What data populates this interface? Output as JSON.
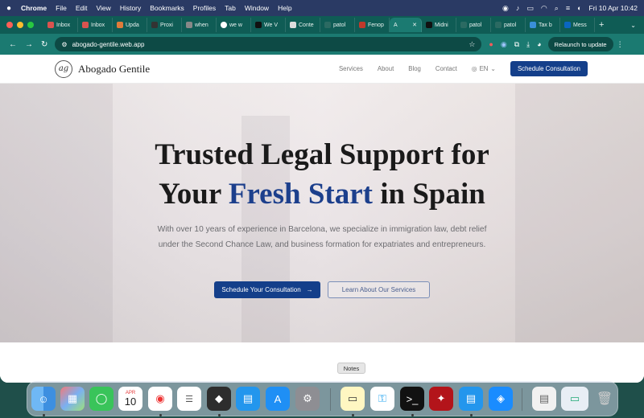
{
  "menubar": {
    "apple": "",
    "items": [
      "Chrome",
      "File",
      "Edit",
      "View",
      "History",
      "Bookmarks",
      "Profiles",
      "Tab",
      "Window",
      "Help"
    ],
    "datetime": "Fri 10 Apr  10:42"
  },
  "browser": {
    "tabs": [
      {
        "label": "Inbox"
      },
      {
        "label": "Inbox"
      },
      {
        "label": "Upda"
      },
      {
        "label": "Proxi"
      },
      {
        "label": "when"
      },
      {
        "label": "we w"
      },
      {
        "label": "We V"
      },
      {
        "label": "Conte"
      },
      {
        "label": "patol"
      },
      {
        "label": "Fenop"
      },
      {
        "label": "A",
        "active": true
      },
      {
        "label": "Midni"
      },
      {
        "label": "patol"
      },
      {
        "label": "patol"
      },
      {
        "label": "Tax b"
      },
      {
        "label": "Mess"
      }
    ],
    "new_tab": "+",
    "url": "abogado-gentile.web.app",
    "relaunch": "Relaunch to update"
  },
  "site": {
    "logo_mark": "ag",
    "logo_text": "Abogado Gentile",
    "nav": [
      "Services",
      "About",
      "Blog",
      "Contact"
    ],
    "lang": "EN",
    "cta": "Schedule Consultation",
    "hero": {
      "title_line1": "Trusted Legal Support for",
      "title_line2_pre": "Your ",
      "title_line2_accent": "Fresh Start",
      "title_line2_post": " in Spain",
      "subtitle": "With over 10 years of experience in Barcelona, we specialize in immigration law, debt relief under the Second Chance Law, and business formation for expatriates and entrepreneurs.",
      "primary_button": "Schedule Your Consultation",
      "secondary_button": "Learn About Our Services"
    }
  },
  "tooltip": "Notes",
  "dock": {
    "calendar_month": "APR",
    "calendar_day": "10"
  }
}
